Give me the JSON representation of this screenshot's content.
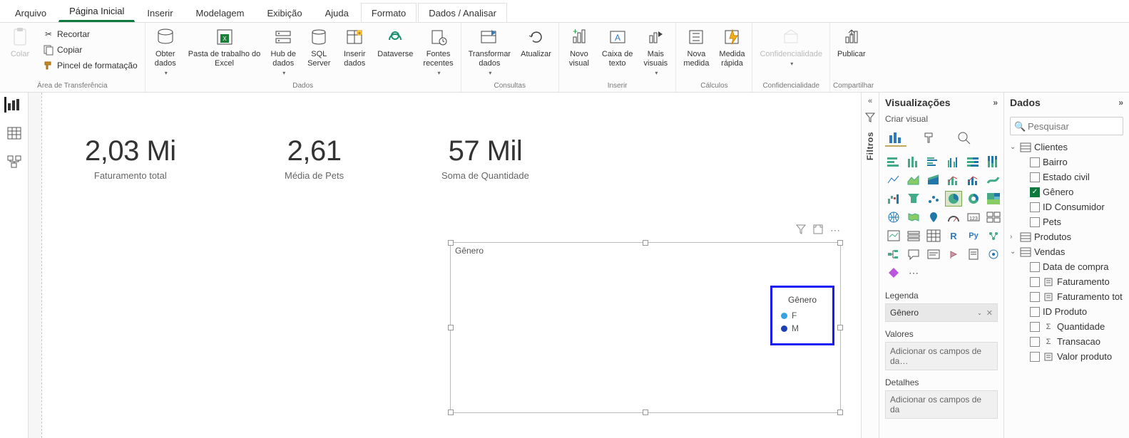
{
  "tabs": {
    "arquivo": "Arquivo",
    "pagina_inicial": "Página Inicial",
    "inserir": "Inserir",
    "modelagem": "Modelagem",
    "exibicao": "Exibição",
    "ajuda": "Ajuda",
    "formato": "Formato",
    "dados_analisar": "Dados / Analisar"
  },
  "ribbon": {
    "clipboard": {
      "colar": "Colar",
      "recortar": "Recortar",
      "copiar": "Copiar",
      "pincel": "Pincel de formatação",
      "group": "Área de Transferência"
    },
    "dados_grp": {
      "obter": "Obter\ndados",
      "excel": "Pasta de trabalho do\nExcel",
      "hub": "Hub de\ndados",
      "sql": "SQL\nServer",
      "inserir": "Inserir\ndados",
      "dataverse": "Dataverse",
      "fontes": "Fontes\nrecentes",
      "group": "Dados"
    },
    "consultas_grp": {
      "transformar": "Transformar\ndados",
      "atualizar": "Atualizar",
      "group": "Consultas"
    },
    "inserir_grp": {
      "novo": "Novo\nvisual",
      "caixa": "Caixa de\ntexto",
      "mais": "Mais\nvisuais",
      "group": "Inserir"
    },
    "calculos_grp": {
      "nova_medida": "Nova\nmedida",
      "medida_rapida": "Medida\nrápida",
      "group": "Cálculos"
    },
    "confid_grp": {
      "label": "Confidencialidade",
      "group": "Confidencialidade"
    },
    "compart_grp": {
      "publicar": "Publicar",
      "group": "Compartilhar"
    }
  },
  "cards": {
    "c1_value": "2,03 Mi",
    "c1_label": "Faturamento total",
    "c2_value": "2,61",
    "c2_label": "Média de Pets",
    "c3_value": "57 Mil",
    "c3_label": "Soma de Quantidade"
  },
  "chart_data": {
    "type": "pie",
    "title": "Gênero",
    "legend_title": "Gênero",
    "series": [
      {
        "name": "F",
        "color": "#35a3e3"
      },
      {
        "name": "M",
        "color": "#1f3fb8"
      }
    ]
  },
  "filters_label": "Filtros",
  "vis_pane": {
    "title": "Visualizações",
    "subtitle": "Criar visual",
    "legenda_label": "Legenda",
    "legenda_value": "Gênero",
    "valores_label": "Valores",
    "valores_ph": "Adicionar os campos de da…",
    "detalhes_label": "Detalhes",
    "detalhes_ph": "Adicionar os campos de da"
  },
  "data_pane": {
    "title": "Dados",
    "search_ph": "Pesquisar",
    "tables": {
      "clientes": {
        "name": "Clientes",
        "expanded": true,
        "fields": [
          {
            "name": "Bairro",
            "checked": false
          },
          {
            "name": "Estado civil",
            "checked": false
          },
          {
            "name": "Gênero",
            "checked": true
          },
          {
            "name": "ID Consumidor",
            "checked": false
          },
          {
            "name": "Pets",
            "checked": false
          }
        ]
      },
      "produtos": {
        "name": "Produtos",
        "expanded": false
      },
      "vendas": {
        "name": "Vendas",
        "expanded": true,
        "fields": [
          {
            "name": "Data de compra",
            "checked": false,
            "icon": ""
          },
          {
            "name": "Faturamento",
            "checked": false,
            "icon": "calc"
          },
          {
            "name": "Faturamento tot",
            "checked": false,
            "icon": "calc"
          },
          {
            "name": "ID Produto",
            "checked": false,
            "icon": ""
          },
          {
            "name": "Quantidade",
            "checked": false,
            "icon": "sum"
          },
          {
            "name": "Transacao",
            "checked": false,
            "icon": "sum"
          },
          {
            "name": "Valor produto",
            "checked": false,
            "icon": "calc"
          }
        ]
      }
    }
  }
}
